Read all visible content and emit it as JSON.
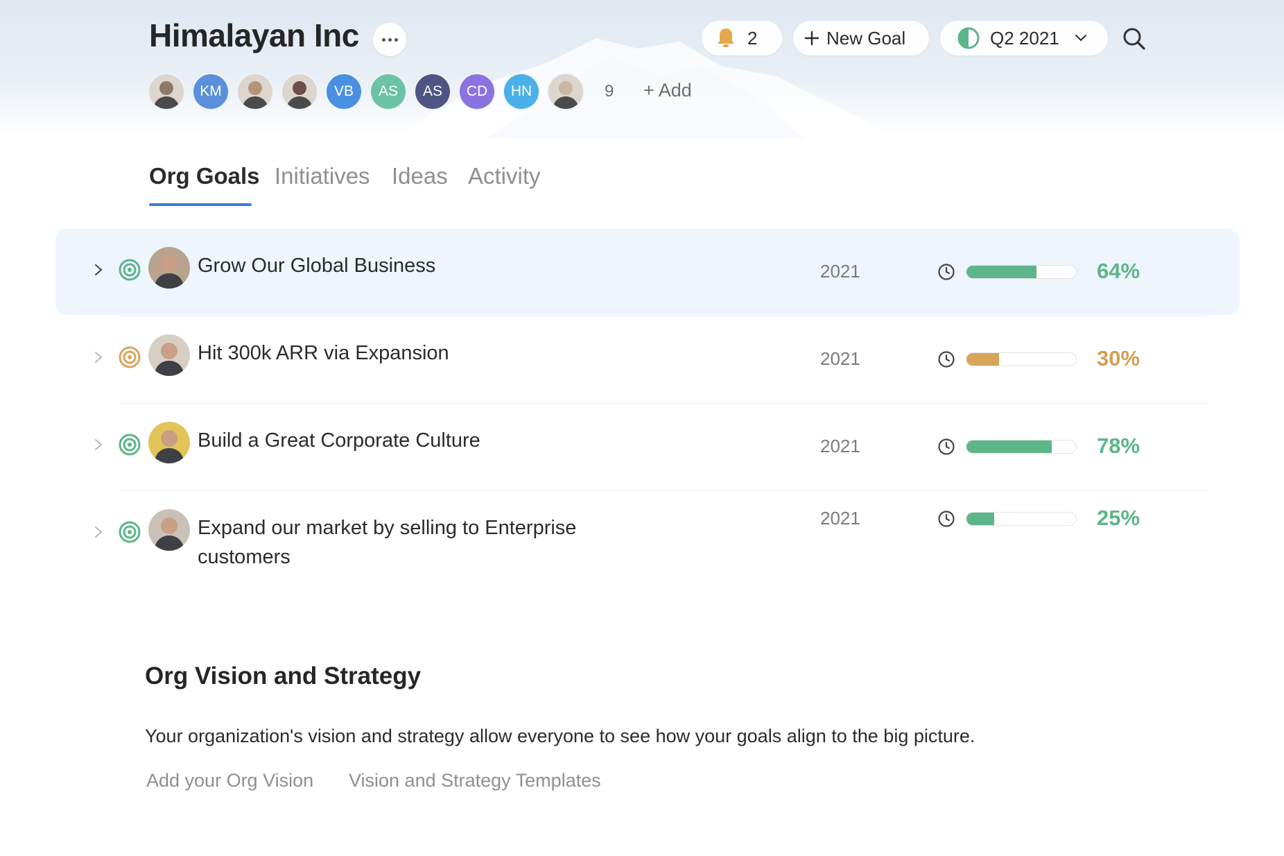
{
  "org": {
    "name": "Himalayan Inc"
  },
  "header": {
    "notifications": {
      "count": "2"
    },
    "new_goal": {
      "label": "New Goal"
    },
    "period": {
      "label": "Q2 2021"
    }
  },
  "members": {
    "avatars": [
      {
        "initials": "",
        "kind": "photo"
      },
      {
        "initials": "KM",
        "color": "#5b8fdc"
      },
      {
        "initials": "",
        "kind": "photo"
      },
      {
        "initials": "",
        "kind": "photo"
      },
      {
        "initials": "VB",
        "color": "#4a90e2"
      },
      {
        "initials": "AS",
        "color": "#6cc2a4"
      },
      {
        "initials": "AS",
        "color": "#4e5582"
      },
      {
        "initials": "CD",
        "color": "#8a73e0"
      },
      {
        "initials": "HN",
        "color": "#4ab0ea"
      },
      {
        "initials": "",
        "kind": "photo"
      }
    ],
    "more_count": "9",
    "add_label": "+ Add"
  },
  "tabs": [
    {
      "label": "Org Goals",
      "active": true
    },
    {
      "label": "Initiatives"
    },
    {
      "label": "Ideas"
    },
    {
      "label": "Activity"
    }
  ],
  "goals": [
    {
      "title": "Grow Our Global Business",
      "year": "2021",
      "progress": 64,
      "progress_label": "64%",
      "status_color": "#5db58a",
      "text_color": "#5db58a"
    },
    {
      "title": "Hit 300k ARR via Expansion",
      "year": "2021",
      "progress": 30,
      "progress_label": "30%",
      "status_color": "#d9a55a",
      "text_color": "#d39f52"
    },
    {
      "title": "Build a Great Corporate Culture",
      "year": "2021",
      "progress": 78,
      "progress_label": "78%",
      "status_color": "#5db58a",
      "text_color": "#5db58a"
    },
    {
      "title": "Expand our market by selling to Enterprise customers",
      "year": "2021",
      "progress": 25,
      "progress_label": "25%",
      "status_color": "#5db58a",
      "text_color": "#5db58a"
    }
  ],
  "vision": {
    "heading": "Org Vision and Strategy",
    "description": "Your organization's vision and strategy allow everyone to see how your goals align to the big picture.",
    "add_link": "Add your Org Vision",
    "templates_link": "Vision and Strategy Templates"
  },
  "colors": {
    "accent": "#3a7bd5",
    "on_track": "#5db58a",
    "at_risk": "#d9a55a",
    "bell": "#e2a84b"
  },
  "icons": [
    "more-dots-icon",
    "bell-icon",
    "plus-icon",
    "half-moon-icon",
    "chevron-down-icon",
    "search-icon",
    "chevron-right-icon",
    "target-icon",
    "clock-icon"
  ]
}
